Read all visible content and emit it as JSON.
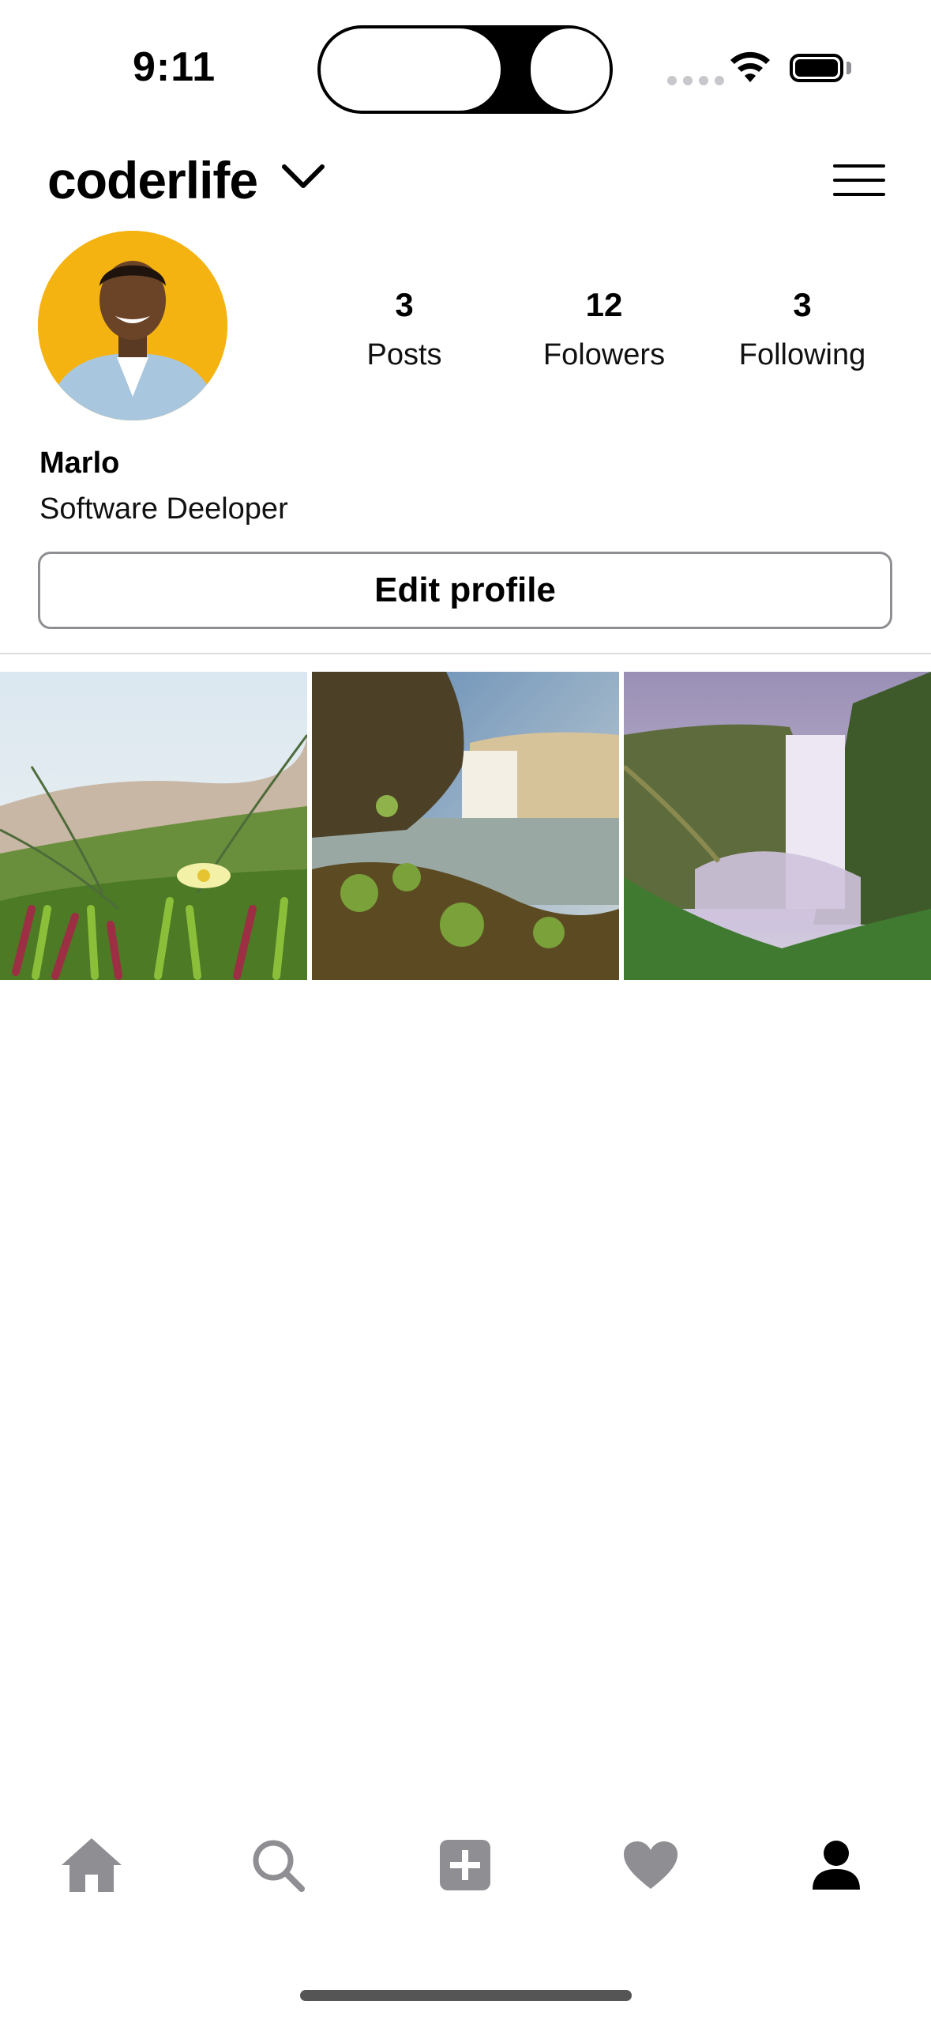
{
  "status_bar": {
    "time": "9:11"
  },
  "header": {
    "username": "coderlife"
  },
  "profile": {
    "stats": [
      {
        "value": "3",
        "label": "Posts"
      },
      {
        "value": "12",
        "label": "Folowers"
      },
      {
        "value": "3",
        "label": "Following"
      }
    ],
    "name": "Marlo",
    "bio": "Software Deeloper",
    "edit_button": "Edit profile"
  },
  "grid": {
    "posts": [
      "flower-photo",
      "waterfall-photo",
      "skogafoss-photo"
    ]
  },
  "tab_bar": {
    "items": [
      "home-icon",
      "search-icon",
      "add-post-icon",
      "heart-icon",
      "profile-icon"
    ],
    "active": "profile-icon"
  },
  "colors": {
    "inactive_icon": "#8e8e93",
    "active_icon": "#000000",
    "avatar_bg": "#f5b312"
  }
}
